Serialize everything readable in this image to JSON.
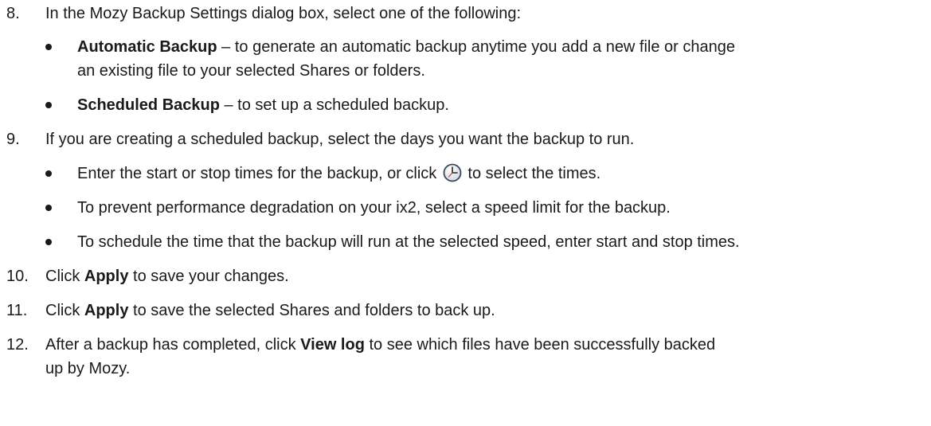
{
  "steps": {
    "s8": {
      "number": "8.",
      "text": "In the Mozy Backup Settings dialog box, select one of the following:",
      "bullets": [
        {
          "bold": "Automatic Backup",
          "text": " – to generate an automatic backup anytime you add a new file or change"
        },
        {
          "continuation": "an existing file to your selected Shares or folders."
        },
        {
          "bold": "Scheduled Backup",
          "text": " – to set up a scheduled backup."
        }
      ]
    },
    "s9": {
      "number": "9.",
      "text": "If you are creating a scheduled backup, select the days you want the backup to run.",
      "bullets": [
        {
          "before": "Enter the start or stop times for the backup, or click ",
          "icon": "clock-icon",
          "after": " to select the times."
        },
        {
          "text": "To prevent performance degradation on your ix2, select a speed limit for the backup."
        },
        {
          "text": "To schedule the time that the backup will run at the selected speed, enter start and stop times."
        }
      ]
    },
    "s10": {
      "number": "10.",
      "before": "Click ",
      "bold": "Apply",
      "after": " to save your changes."
    },
    "s11": {
      "number": "11.",
      "before": "Click ",
      "bold": "Apply",
      "after": " to save the selected Shares and folders to back up."
    },
    "s12": {
      "number": "12.",
      "before": "After a backup has completed, click ",
      "bold": "View log",
      "after": " to see which files have been successfully backed",
      "continuation": "up by Mozy."
    }
  }
}
